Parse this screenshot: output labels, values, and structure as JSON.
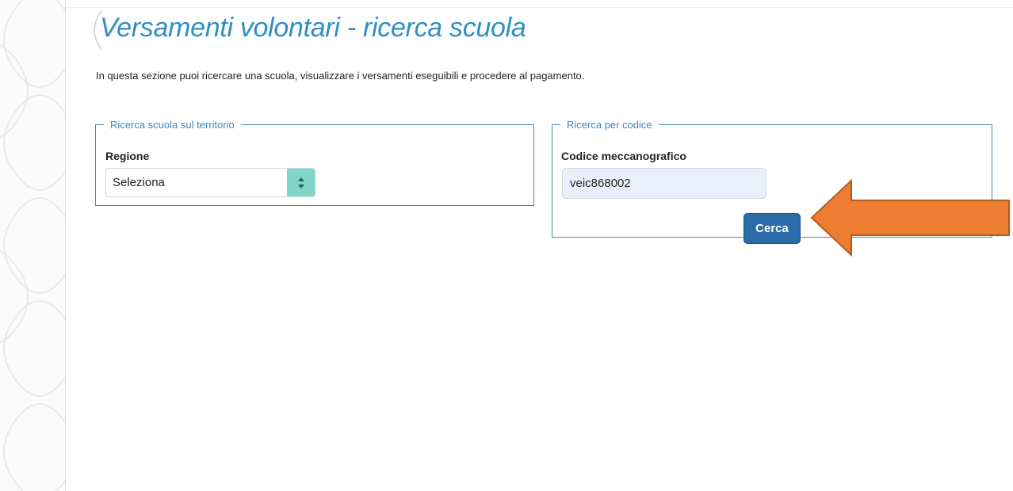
{
  "page": {
    "title": "Versamenti volontari - ricerca scuola",
    "intro": "In questa sezione puoi ricercare una scuola, visualizzare i versamenti eseguibili e procedere al pagamento."
  },
  "territorio": {
    "legend": "Ricerca scuola sul territorio",
    "regione_label": "Regione",
    "regione_value": "Seleziona"
  },
  "codice": {
    "legend": "Ricerca per codice",
    "field_label": "Codice meccanografico",
    "field_value": "veic868002",
    "search_button": "Cerca"
  },
  "colors": {
    "title": "#2f8fc4",
    "fieldset_border": "#3d86c6",
    "button": "#2c6aa8",
    "select_arrow": "#7fd6c8",
    "annotation_arrow": "#ed7d31"
  },
  "icons": {
    "select_arrow": "updown-chevron-icon",
    "annotation": "left-arrow-annotation"
  }
}
